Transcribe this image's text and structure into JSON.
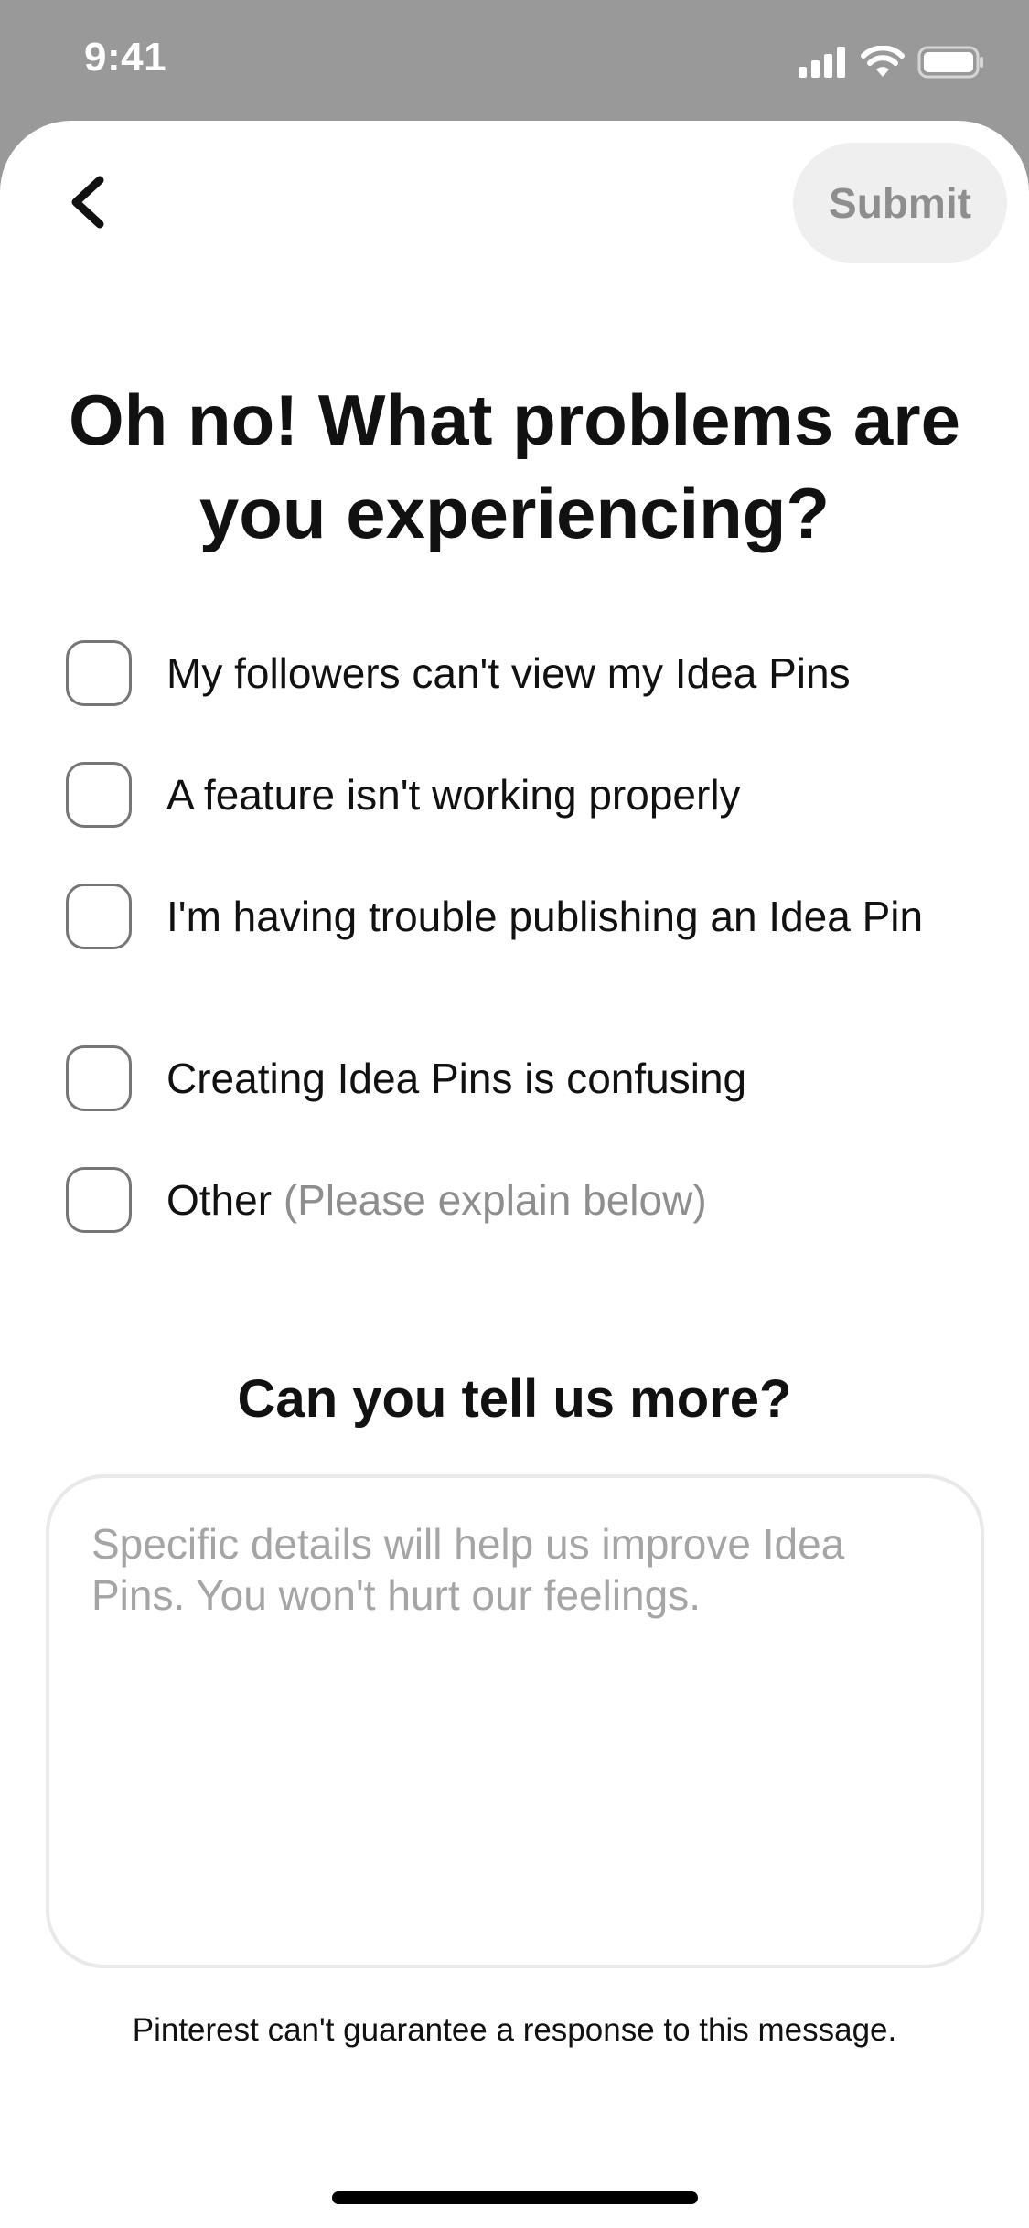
{
  "status_bar": {
    "time": "9:41",
    "icons": [
      "cellular-signal-icon",
      "wifi-icon",
      "battery-icon"
    ]
  },
  "header": {
    "back_icon": "chevron-left-icon",
    "submit_label": "Submit"
  },
  "title": "Oh no! What problems are you experiencing?",
  "options": [
    {
      "label": "My followers can't view my Idea Pins",
      "hint": "",
      "checked": false
    },
    {
      "label": "A feature isn't working properly",
      "hint": "",
      "checked": false
    },
    {
      "label": "I'm having trouble publishing an Idea Pin",
      "hint": "",
      "checked": false
    },
    {
      "label": "Creating Idea Pins is confusing",
      "hint": "",
      "checked": false
    },
    {
      "label": "Other",
      "hint": "(Please explain below)",
      "checked": false
    }
  ],
  "more": {
    "title": "Can you tell us more?",
    "placeholder": "Specific details will help us improve Idea Pins. You won't hurt our feelings.",
    "value": ""
  },
  "disclaimer": "Pinterest can't guarantee a response to this message.",
  "colors": {
    "backdrop": "#999999",
    "submit_bg": "#efefef",
    "submit_text": "#8e8e8e",
    "placeholder": "#a5a5a5",
    "text": "#111111"
  }
}
